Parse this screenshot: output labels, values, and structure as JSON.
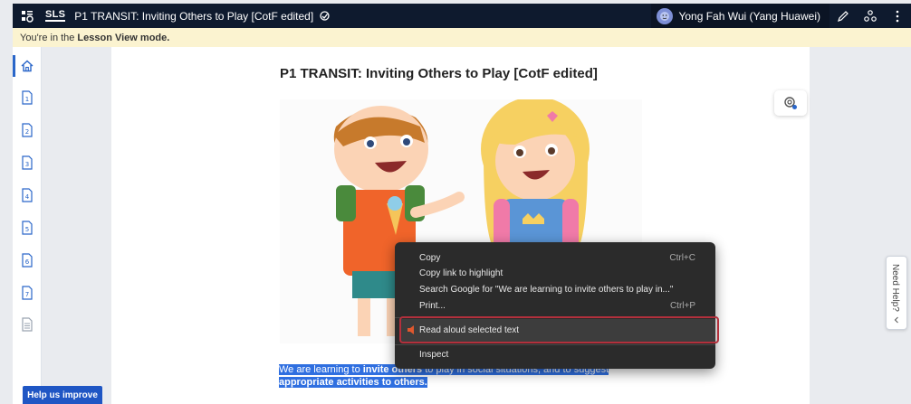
{
  "topbar": {
    "logo": "SLS",
    "title": "P1 TRANSIT: Inviting Others to Play [CotF edited]",
    "user_name": "Yong Fah Wui (Yang Huawei)"
  },
  "banner": {
    "prefix": "You're in the",
    "mode": "Lesson View mode."
  },
  "rail": {
    "items": [
      "1",
      "2",
      "3",
      "4",
      "5",
      "6",
      "7"
    ]
  },
  "content": {
    "title": "P1 TRANSIT: Inviting Others to Play [CotF edited]",
    "selected_text": {
      "part1": "We are learning to ",
      "bold": "invite others",
      "part2": " to play in social situations, and to suggest ",
      "line2": "appropriate activities to others."
    }
  },
  "context_menu": {
    "copy": "Copy",
    "copy_shortcut": "Ctrl+C",
    "copy_link": "Copy link to highlight",
    "search_google": "Search Google for \"We are learning to invite others to play in...\"",
    "print": "Print...",
    "print_shortcut": "Ctrl+P",
    "read_aloud": "Read aloud selected text",
    "inspect": "Inspect"
  },
  "need_help": {
    "label": "Need Help?"
  },
  "improve_button": {
    "label": "Help us improve"
  },
  "colors": {
    "topbar": "#0e1a2e",
    "banner": "#fbf3d0",
    "selection": "#2f6fe0",
    "highlight_border": "#b3303c",
    "improve_button": "#1f56c4"
  }
}
